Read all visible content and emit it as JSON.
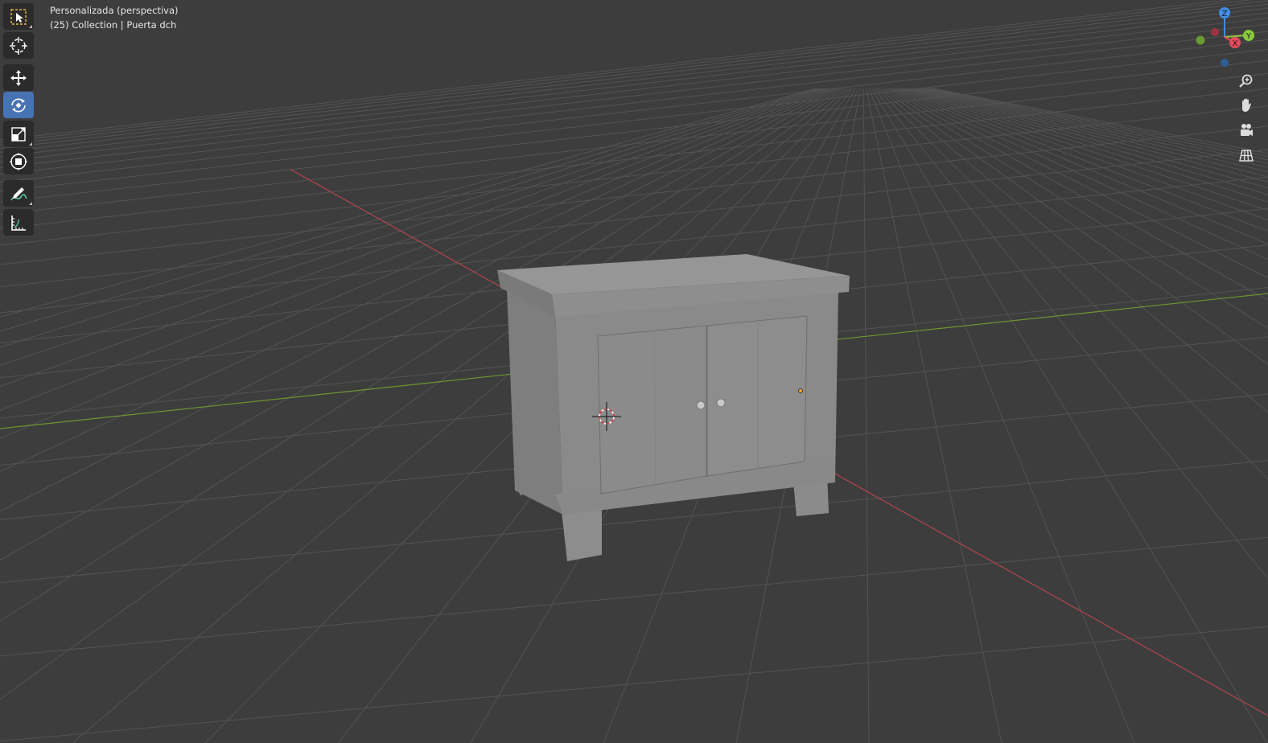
{
  "viewport": {
    "title": "Personalizada (perspectiva)",
    "collection_info": "(25) Collection | Puerta dch"
  },
  "toolbar": {
    "tools": [
      {
        "name": "select-box-tool",
        "icon": "select-box-icon",
        "active": false
      },
      {
        "name": "cursor-tool",
        "icon": "cursor-icon",
        "active": false
      },
      {
        "name": "move-tool",
        "icon": "move-icon",
        "active": false
      },
      {
        "name": "rotate-tool",
        "icon": "rotate-icon",
        "active": true
      },
      {
        "name": "scale-tool",
        "icon": "scale-icon",
        "active": false
      },
      {
        "name": "transform-tool",
        "icon": "transform-icon",
        "active": false
      },
      {
        "name": "annotate-tool",
        "icon": "annotate-icon",
        "active": false
      },
      {
        "name": "measure-tool",
        "icon": "measure-icon",
        "active": false
      }
    ]
  },
  "gizmo": {
    "z_label": "Z",
    "y_label": "Y",
    "x_label": "X",
    "colors": {
      "x": "#e84b5a",
      "y": "#8ac83c",
      "z": "#3f8de8",
      "x_neg": "#9b3442",
      "y_neg": "#6a9a32",
      "z_neg": "#2f5d9a"
    }
  },
  "nav_buttons": [
    {
      "name": "zoom-button",
      "icon": "zoom-in-icon"
    },
    {
      "name": "pan-button",
      "icon": "hand-icon"
    },
    {
      "name": "camera-view-button",
      "icon": "camera-icon"
    },
    {
      "name": "ortho-toggle-button",
      "icon": "grid-icon"
    }
  ],
  "colors": {
    "background": "#3d3d3d",
    "grid": "#515151",
    "x_axis": "#b24550",
    "y_axis": "#6c9631",
    "active_tool": "#4772b3",
    "object": "#8c8c8c"
  }
}
